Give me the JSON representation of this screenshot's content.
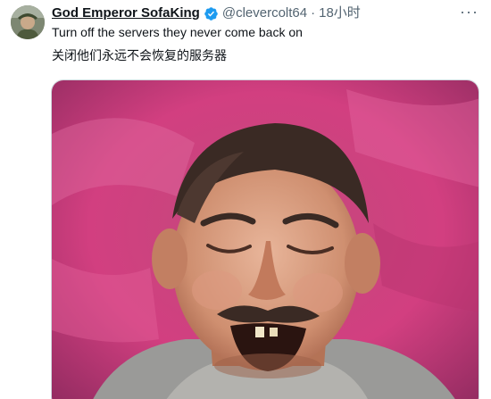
{
  "tweet": {
    "display_name": "God Emperor SofaKing",
    "handle": "@clevercolt64",
    "separator": "·",
    "time": "18小时",
    "more_label": "···",
    "text_line_1": "Turn off the servers they never come back on",
    "text_line_2": "关闭他们永远不会恢复的服务器",
    "verified": true,
    "accent_color": "#1d9bf0"
  },
  "icons": {
    "verified": "verified-badge-icon",
    "more": "more-options-icon"
  }
}
